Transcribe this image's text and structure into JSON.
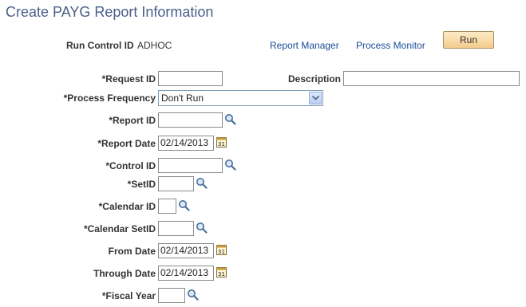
{
  "page": {
    "title": "Create PAYG Report Information"
  },
  "run_control": {
    "label": "Run Control ID",
    "value": "ADHOC"
  },
  "links": {
    "report_manager": "Report Manager",
    "process_monitor": "Process Monitor"
  },
  "run_button": "Run",
  "fields": {
    "request_id": {
      "label": "*Request ID",
      "value": ""
    },
    "description": {
      "label": "Description",
      "value": ""
    },
    "process_frequency": {
      "label": "*Process Frequency",
      "value": "Don't Run"
    },
    "report_id": {
      "label": "*Report ID",
      "value": ""
    },
    "report_date": {
      "label": "*Report Date",
      "value": "02/14/2013"
    },
    "control_id": {
      "label": "*Control ID",
      "value": ""
    },
    "setid": {
      "label": "*SetID",
      "value": ""
    },
    "calendar_id": {
      "label": "*Calendar ID",
      "value": ""
    },
    "calendar_setid": {
      "label": "*Calendar SetID",
      "value": ""
    },
    "from_date": {
      "label": "From Date",
      "value": "02/14/2013"
    },
    "through_date": {
      "label": "Through Date",
      "value": "02/14/2013"
    },
    "fiscal_year": {
      "label": "*Fiscal Year",
      "value": ""
    }
  },
  "icons": {
    "lookup": "magnifier-icon",
    "calendar": "calendar-icon",
    "dropdown": "chevron-down-icon"
  },
  "colors": {
    "title": "#4b5f8a",
    "link": "#1a4b9a",
    "button": "#f4cc8e"
  }
}
